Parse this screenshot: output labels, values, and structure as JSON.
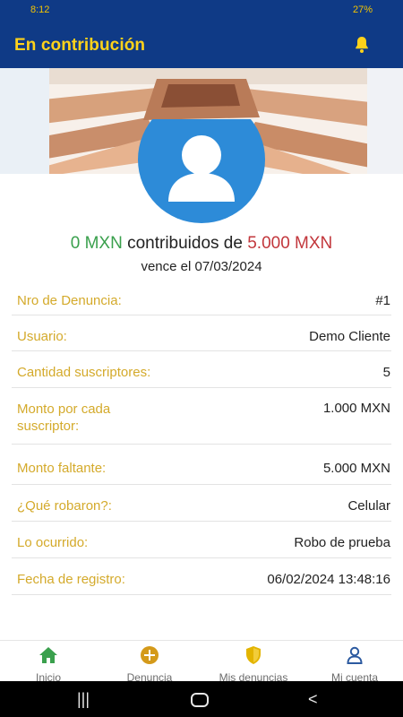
{
  "status_bar": {
    "left_text": "8:12",
    "right_text": "27%"
  },
  "header": {
    "title": "En contribución",
    "icon": "bell-icon"
  },
  "summary": {
    "contributed": "0 MXN",
    "middle_text": "contribuidos de",
    "goal": "5.000 MXN",
    "due_text": "vence el 07/03/2024",
    "colors": {
      "contributed": "#3aa04d",
      "goal": "#c2373c",
      "label": "#d4aa2b",
      "appbar": "#0f3a86",
      "accent": "#ffd21a"
    }
  },
  "details": [
    {
      "label": "Nro de Denuncia:",
      "value": "#1"
    },
    {
      "label": "Usuario:",
      "value": "Demo Cliente"
    },
    {
      "label": "Cantidad suscriptores:",
      "value": "5"
    },
    {
      "label": "Monto por cada\nsuscriptor:",
      "value": "1.000 MXN"
    },
    {
      "label": "Monto faltante:",
      "value": "5.000 MXN"
    },
    {
      "label": "¿Qué robaron?:",
      "value": "Celular"
    },
    {
      "label": "Lo ocurrido:",
      "value": "Robo de prueba"
    },
    {
      "label": "Fecha de registro:",
      "value": "06/02/2024 13:48:16"
    }
  ],
  "bottom_nav": [
    {
      "label": "Inicio",
      "icon": "home-icon",
      "color": "#3aa04d"
    },
    {
      "label": "Denuncia",
      "icon": "add-circle-icon",
      "color": "#d49a1a"
    },
    {
      "label": "Mis denuncias",
      "icon": "shield-icon",
      "color": "#e3b400"
    },
    {
      "label": "Mi cuenta",
      "icon": "user-icon",
      "color": "#2c5aa0"
    }
  ]
}
